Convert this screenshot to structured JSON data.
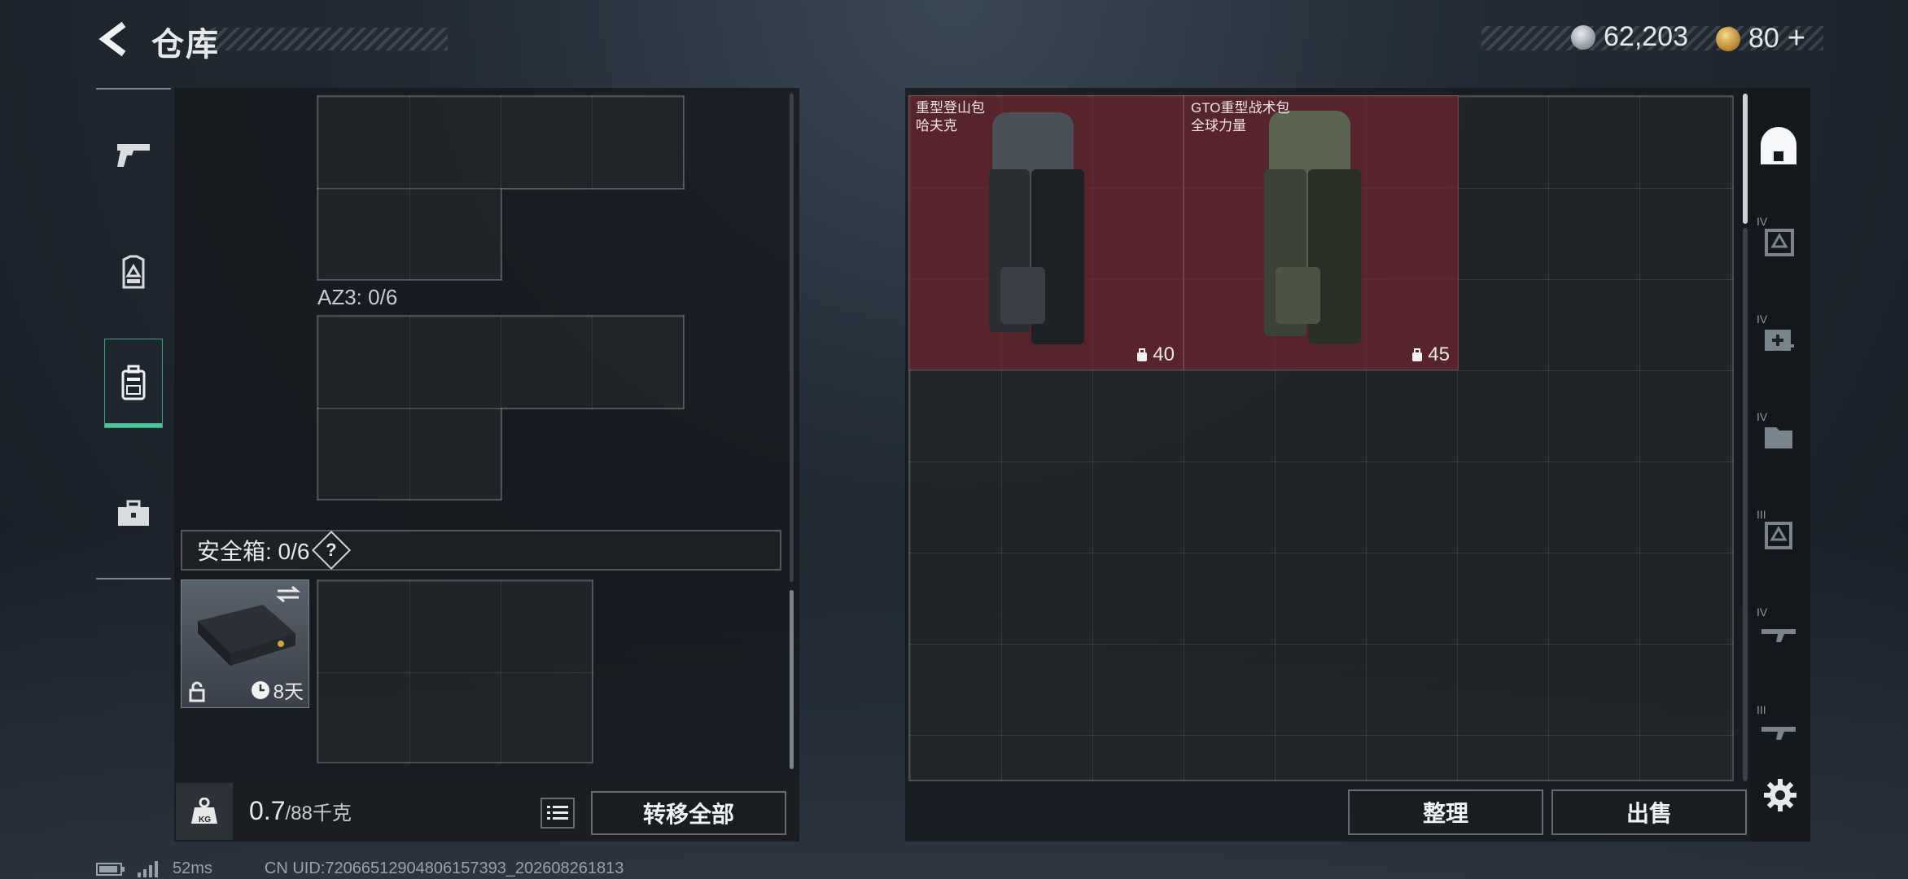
{
  "header": {
    "title": "仓库",
    "currency_silver": "62,203",
    "currency_gold": "80",
    "gold_plus": "+"
  },
  "left_nav": {
    "items": [
      {
        "name": "weapons",
        "icon": "pistol-icon"
      },
      {
        "name": "armor",
        "icon": "armor-vest-icon"
      },
      {
        "name": "backpack",
        "icon": "backpack-icon",
        "active": true
      },
      {
        "name": "case",
        "icon": "briefcase-icon"
      }
    ]
  },
  "loadout": {
    "slot_label": "AZ3: 0/6",
    "safebox_label": "安全箱: 0/6",
    "safebox_help": "?",
    "case_timer": "8天",
    "weight_current": "0.7",
    "weight_max": "/88千克",
    "weight_icon_label": "KG",
    "transfer_all": "转移全部"
  },
  "storage": {
    "items": [
      {
        "name_line1": "重型登山包",
        "name_line2": "哈夫克",
        "capacity": "40",
        "color": "#4a5058"
      },
      {
        "name_line1": "GTO重型战术包",
        "name_line2": "全球力量",
        "capacity": "45",
        "color": "#5a6450"
      }
    ],
    "sort_label": "整理",
    "sell_label": "出售"
  },
  "categories": [
    {
      "icon": "helmet-icon",
      "tier": ""
    },
    {
      "icon": "armor-tier-icon",
      "tier": "IV"
    },
    {
      "icon": "medkit-tier-icon",
      "tier": "IV"
    },
    {
      "icon": "folder-tier-icon",
      "tier": "IV"
    },
    {
      "icon": "armor-tier-icon",
      "tier": "III"
    },
    {
      "icon": "rifle-tier-icon",
      "tier": "IV"
    },
    {
      "icon": "rifle-tier-icon",
      "tier": "III"
    }
  ],
  "footer": {
    "ping": "52ms",
    "uid": "CN UID:7206651290480615739​3_202608261813"
  },
  "colors": {
    "accent": "#49c79a",
    "item_bg": "#6e242c"
  }
}
